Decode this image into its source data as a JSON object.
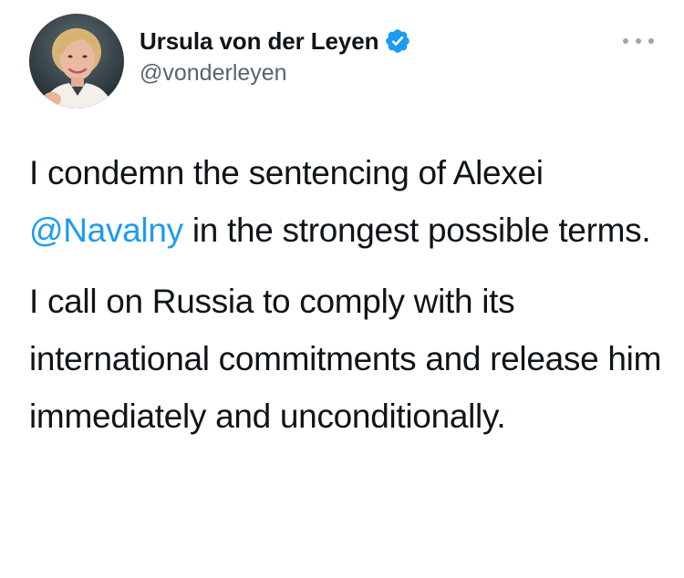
{
  "tweet": {
    "author": {
      "display_name": "Ursula von der Leyen",
      "handle": "@vonderleyen",
      "verified": true,
      "verified_icon": "verified-badge-icon",
      "avatar_icon": "profile-photo"
    },
    "more_icon": "more-options-icon",
    "paragraph1": {
      "part1": "I condemn the sentencing of Alexei ",
      "mention": "@Navalny",
      "part2": " in the strongest possible terms."
    },
    "paragraph2": "I call on Russia to comply with its international commitments and release him immediately and unconditionally."
  },
  "colors": {
    "text": "#0f1419",
    "secondary_text": "#536471",
    "mention": "#1d9bf0",
    "verified_badge": "#1d9bf0"
  }
}
